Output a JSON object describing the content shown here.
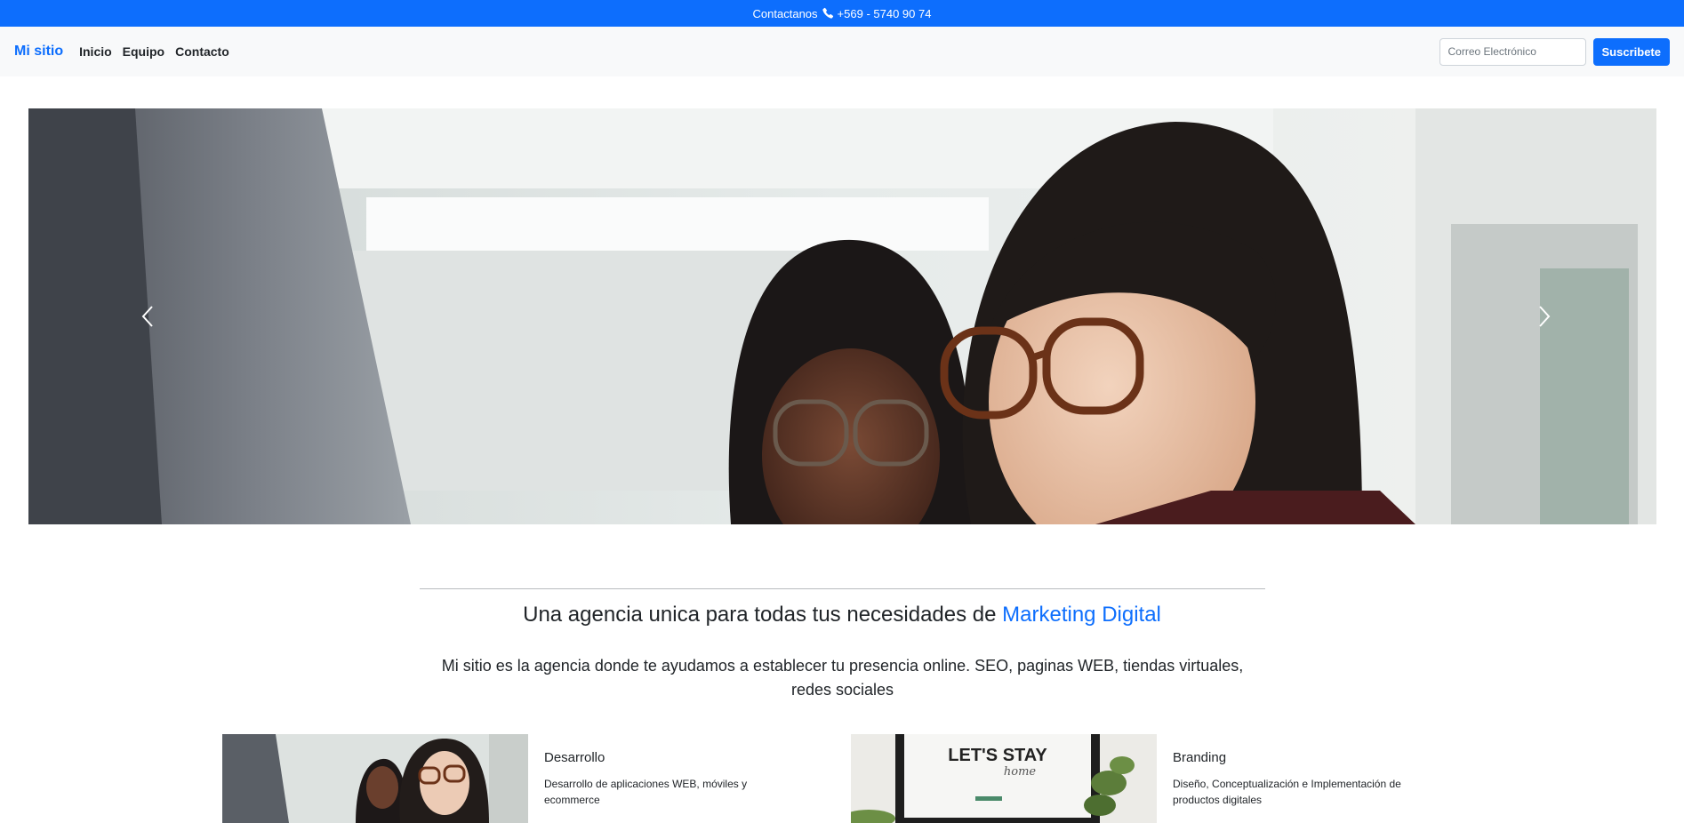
{
  "topbar": {
    "contact_label": "Contactanos",
    "phone": "+569 - 5740 90 74",
    "icon": "phone-icon"
  },
  "navbar": {
    "brand": "Mi sitio",
    "links": [
      "Inicio",
      "Equipo",
      "Contacto"
    ],
    "email_placeholder": "Correo Electrónico",
    "subscribe_label": "Suscribete"
  },
  "carousel": {
    "prev_icon": "chevron-left-icon",
    "next_icon": "chevron-right-icon"
  },
  "intro": {
    "headline_prefix": "Una agencia unica para todas tus necesidades de",
    "headline_accent": "Marketing Digital",
    "lead": "Mi sitio es la agencia donde te ayudamos a establecer tu presencia online. SEO, paginas WEB, tiendas virtuales, redes sociales"
  },
  "services": [
    {
      "title": "Desarrollo",
      "text": "Desarrollo de aplicaciones WEB, móviles y ecommerce"
    },
    {
      "title": "Branding",
      "text": "Diseño, Conceptualización e Implementación de productos digitales",
      "image_text": "LET'S STAY",
      "image_subtext": "home"
    }
  ],
  "colors": {
    "primary": "#0d6efd",
    "navbar_bg": "#f8f9fa",
    "text": "#212529"
  }
}
